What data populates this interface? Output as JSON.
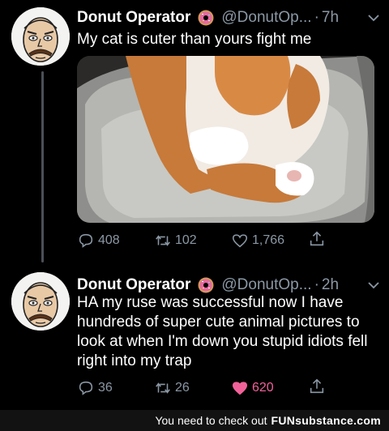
{
  "tweets": [
    {
      "display_name": "Donut Operator",
      "handle": "@DonutOp...",
      "time": "7h",
      "separator": "·",
      "text": "My cat is cuter than yours fight me",
      "replies": "408",
      "retweets": "102",
      "likes": "1,766",
      "liked": false,
      "has_media": true
    },
    {
      "display_name": "Donut Operator",
      "handle": "@DonutOp...",
      "time": "2h",
      "separator": "·",
      "text": "HA my ruse was successful now I have hundreds of super cute animal pictures to look at when I'm down you stupid idiots fell right into my trap",
      "replies": "36",
      "retweets": "26",
      "likes": "620",
      "liked": true,
      "has_media": false
    }
  ],
  "footer": {
    "message": "You need to check out",
    "brand": "FUNsubstance.com"
  },
  "colors": {
    "background": "#000000",
    "muted": "#8b98a5",
    "like_active": "#f1629a",
    "thread_line": "#4a5058"
  },
  "icons": [
    "avatar-face",
    "donut-icon",
    "chevron-down-icon",
    "reply-icon",
    "retweet-icon",
    "like-icon",
    "share-icon"
  ]
}
